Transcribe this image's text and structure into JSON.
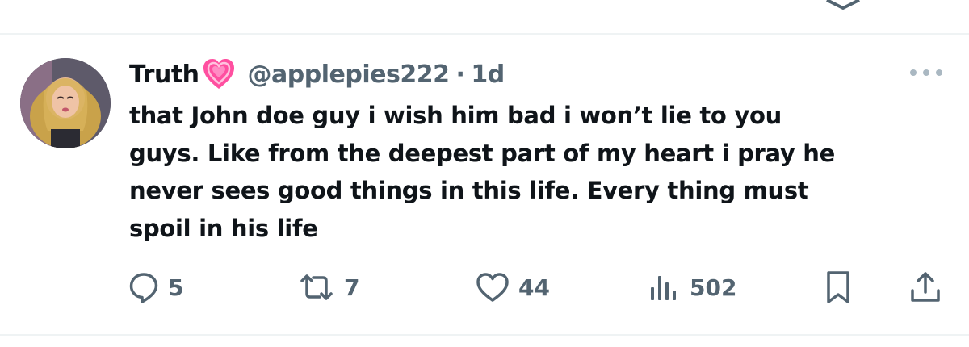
{
  "tweet": {
    "display_name": "Truth",
    "name_emoji": "growing-heart-emoji",
    "handle": "@applepies222",
    "separator": "·",
    "time": "1d",
    "text": "that John doe guy i wish him bad i won’t lie to you\nguys. Like from the deepest part of my heart i pray he\nnever sees good things in this life. Every thing must\nspoil in his life"
  },
  "actions": {
    "replies": "5",
    "reposts": "7",
    "likes": "44",
    "views": "502"
  },
  "icons": {
    "more": "more-horizontal-icon",
    "reply": "reply-bubble-icon",
    "repost": "repost-arrows-icon",
    "like": "heart-outline-icon",
    "views": "views-bars-icon",
    "bookmark": "bookmark-icon",
    "share": "share-upload-icon"
  },
  "colors": {
    "text": "#0f1419",
    "secondary": "#536471",
    "divider": "#eff3f4",
    "heart_pink": "#ff4fa0"
  }
}
